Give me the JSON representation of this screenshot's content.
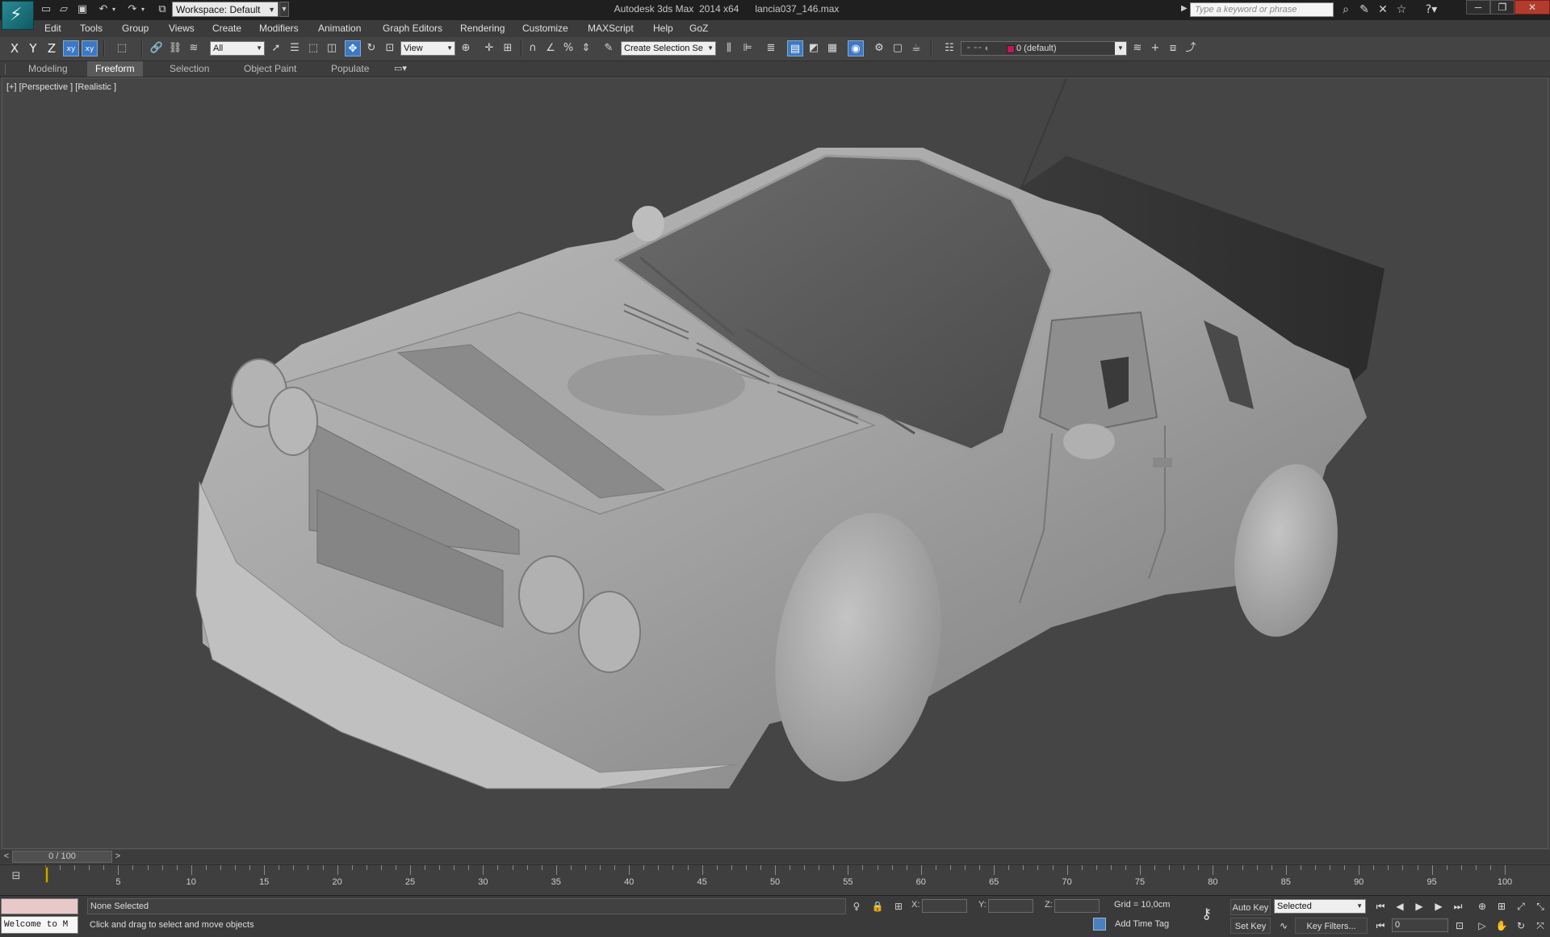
{
  "titlebar": {
    "workspace": "Workspace: Default",
    "title": "Autodesk 3ds Max  2014 x64      lancia037_146.max",
    "search_placeholder": "Type a keyword or phrase"
  },
  "menu": [
    "Edit",
    "Tools",
    "Group",
    "Views",
    "Create",
    "Modifiers",
    "Animation",
    "Graph Editors",
    "Rendering",
    "Customize",
    "MAXScript",
    "Help",
    "GoZ"
  ],
  "toolbar": {
    "axes": [
      "X",
      "Y",
      "Z"
    ],
    "selection_filter": "All",
    "reference_coord": "View",
    "named_selection": "Create Selection Se",
    "layer": "0 (default)"
  },
  "ribbon": {
    "tabs": [
      "Modeling",
      "Freeform",
      "Selection",
      "Object Paint",
      "Populate"
    ],
    "active": "Freeform"
  },
  "viewport": {
    "label": "[+] [Perspective ] [Realistic ]"
  },
  "timeslider": {
    "position": "0 / 100",
    "prev": "<",
    "next": ">"
  },
  "trackbar": {
    "labels": [
      "5",
      "10",
      "15",
      "20",
      "25",
      "30",
      "35",
      "40",
      "45",
      "50",
      "55",
      "60",
      "65",
      "70",
      "75",
      "80",
      "85",
      "90",
      "95",
      "100"
    ]
  },
  "status": {
    "maxscript_text": "Welcome to M",
    "selection": "None Selected",
    "prompt": "Click and drag to select and move objects",
    "x_label": "X:",
    "y_label": "Y:",
    "z_label": "Z:",
    "x_value": "",
    "y_value": "",
    "z_value": "",
    "grid": "Grid = 10,0cm",
    "add_time_tag": "Add Time Tag",
    "auto_key": "Auto Key",
    "set_key": "Set Key",
    "selected_option": "Selected",
    "key_filters": "Key Filters...",
    "current_frame": "0"
  }
}
